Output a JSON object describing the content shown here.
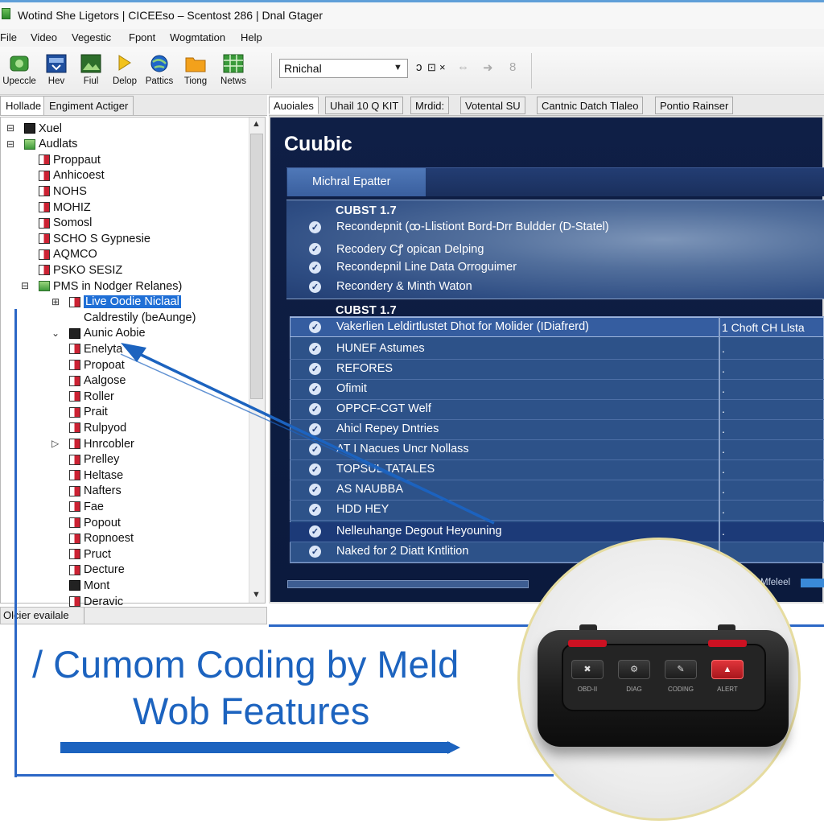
{
  "window": {
    "title": "Wotind She Ligetors | CICEEso – Scentost 286 | Dnal Gtager"
  },
  "menu": [
    "File",
    "Video",
    "Vegestic",
    "Fpont",
    "Wogmtation",
    "Help"
  ],
  "toolbar": {
    "buttons": [
      {
        "label": "Upeccle",
        "icon": "update-icon"
      },
      {
        "label": "Hev",
        "icon": "window-icon"
      },
      {
        "label": "Fiul",
        "icon": "image-icon"
      },
      {
        "label": "Delop",
        "icon": "flag-icon"
      },
      {
        "label": "Pattics",
        "icon": "globe-icon"
      },
      {
        "label": "Tiong",
        "icon": "folder-icon"
      },
      {
        "label": "Netws",
        "icon": "grid-icon"
      }
    ],
    "combo_value": "Rnichal",
    "extra": {
      "a": "ↄ",
      "b": "⊡",
      "c": "×",
      "d": "⇔",
      "e": "➜",
      "f": "8"
    }
  },
  "left_tabs": [
    "Hollade",
    "Engiment Actiger"
  ],
  "tree": [
    {
      "label": "Xuel",
      "icon": "dark"
    },
    {
      "label": "Audlats",
      "icon": "green"
    },
    {
      "label": "Proppaut",
      "icon": "file"
    },
    {
      "label": "Anhicoest",
      "icon": "file"
    },
    {
      "label": "NOHS",
      "icon": "file"
    },
    {
      "label": "MOHIZ",
      "icon": "file"
    },
    {
      "label": "Somosl",
      "icon": "file"
    },
    {
      "label": "SCHO S Gypnesie",
      "icon": "file"
    },
    {
      "label": "AQMCO",
      "icon": "file"
    },
    {
      "label": "PSKO SESIZ",
      "icon": "file"
    },
    {
      "label": "PMS in Nodger Relanes)",
      "icon": "green"
    },
    {
      "label": "Live Oodie Niclaal",
      "icon": "file"
    },
    {
      "label": "Caldrestily (beAunge)",
      "icon": "none"
    },
    {
      "label": "Aunic Aobie",
      "icon": "dark"
    },
    {
      "label": "Enelyta",
      "icon": "file"
    },
    {
      "label": "Propoat",
      "icon": "file"
    },
    {
      "label": "Aalgose",
      "icon": "file"
    },
    {
      "label": "Roller",
      "icon": "file"
    },
    {
      "label": "Prait",
      "icon": "file"
    },
    {
      "label": "Rulpyod",
      "icon": "file"
    },
    {
      "label": "Hnrcobler",
      "icon": "file"
    },
    {
      "label": "Prelley",
      "icon": "file"
    },
    {
      "label": "Heltase",
      "icon": "file"
    },
    {
      "label": "Nafters",
      "icon": "file"
    },
    {
      "label": "Fae",
      "icon": "file"
    },
    {
      "label": "Popout",
      "icon": "file"
    },
    {
      "label": "Ropnoest",
      "icon": "file"
    },
    {
      "label": "Pruct",
      "icon": "file"
    },
    {
      "label": "Decture",
      "icon": "file"
    },
    {
      "label": "Mont",
      "icon": "dark"
    },
    {
      "label": "Deravic",
      "icon": "file"
    }
  ],
  "status": "Olcier evailale",
  "right_tabs": [
    "Auoiales",
    "Uhail 10 Q KIT",
    "Mrdid:",
    "Votental SU",
    "Cantnic Datch Tlaleo",
    "Pontio Rainser"
  ],
  "panel": {
    "title": "Cuubic",
    "subheader_tab": "Michral Epatter",
    "group1": {
      "title": "CUBST 1.7",
      "items": [
        "Recondepnit (ꝏ-Llistiont Bord-Drr Buldder (D-Statel)",
        "Recodery Cꝭ opican Delping",
        "Recondepnil Line Data Orroguimer",
        "Recondery & Minth Waton"
      ]
    },
    "group2": {
      "title": "CUBST 1.7",
      "header": {
        "label": "Vakerlien Leldirtlustet Dhot for Molider (IDiafrerd)",
        "col2": "1  Choft CH Llsta"
      },
      "rows": [
        {
          "label": "HUNEF Astumes",
          "col2": "."
        },
        {
          "label": "REFORES",
          "col2": "."
        },
        {
          "label": "Ofimit",
          "col2": "."
        },
        {
          "label": "OPPCF-CGT Welf",
          "col2": "."
        },
        {
          "label": "Ahicl Repey Dntries",
          "col2": "."
        },
        {
          "label": "AT I Nacues Uncr Nollass",
          "col2": "."
        },
        {
          "label": "TOPSUL TATALES",
          "col2": "."
        },
        {
          "label": "AS NAUBBA",
          "col2": "."
        },
        {
          "label": "HDD HEY",
          "col2": "."
        },
        {
          "label": "Nelleuhange Degout Heyouning",
          "col2": "."
        },
        {
          "label": "Naked for 2 Diatt Kntlition",
          "col2": ""
        }
      ]
    },
    "hscroll_label": "Mfeleel"
  },
  "headline": {
    "line1": "/ Cumom Coding by Meld",
    "line2": "Wob Features"
  },
  "device": {
    "buttons": [
      {
        "symbol": "✖",
        "label": "OBD-II"
      },
      {
        "symbol": "⚙",
        "label": "DIAG"
      },
      {
        "symbol": "✎",
        "label": "CODING"
      },
      {
        "symbol": "▲",
        "label": "ALERT"
      }
    ]
  },
  "colors": {
    "accent": "#1c63bf",
    "panel_bg": "#0f1f46",
    "selection": "#1f6fd6",
    "alert": "#d9262d"
  }
}
